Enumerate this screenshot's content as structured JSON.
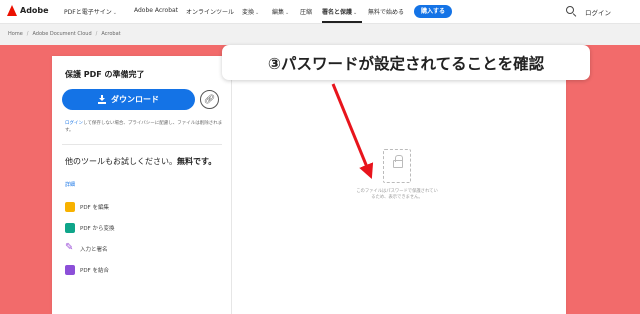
{
  "topnav": {
    "logo_text": "Adobe",
    "items": [
      {
        "label": "PDFと電子サイン",
        "chevron": true
      },
      {
        "label": "Adobe Acrobat",
        "chevron": false
      },
      {
        "label": "オンラインツール",
        "chevron": false
      },
      {
        "label": "変換",
        "chevron": true
      },
      {
        "label": "編集",
        "chevron": true
      },
      {
        "label": "圧縮",
        "chevron": false
      },
      {
        "label": "署名と保護",
        "chevron": true,
        "active": true
      },
      {
        "label": "無料で始める",
        "chevron": false
      }
    ],
    "buy_label": "購入する",
    "login_label": "ログイン"
  },
  "breadcrumb": [
    "Home",
    "Adobe Document Cloud",
    "Acrobat"
  ],
  "panel": {
    "title": "保護 PDF の準備完了",
    "download_label": "ダウンロード",
    "note_link": "ログイン",
    "note_text": "して保存しない場合、プライバシーに配慮し、ファイルは削除されます。",
    "try_text": "他のツールもお試しください。",
    "try_bold": "無料です。",
    "detail_link": "詳細",
    "tools": [
      {
        "label": "PDF を編集",
        "icon": "pdf-edit-icon"
      },
      {
        "label": "PDF から変換",
        "icon": "pdf-convert-icon"
      },
      {
        "label": "入力と署名",
        "icon": "fill-sign-icon"
      },
      {
        "label": "PDF を結合",
        "icon": "pdf-merge-icon"
      }
    ]
  },
  "preview": {
    "icon": "lock-icon",
    "message": "このファイルはパスワードで保護されているため、表示できません。"
  },
  "callout": {
    "text": "③パスワードが設定されてることを確認"
  },
  "colors": {
    "accent": "#1473e6",
    "annotation_bg": "#f26b6b",
    "arrow": "#e8141c",
    "adobe_red": "#eb1000"
  }
}
